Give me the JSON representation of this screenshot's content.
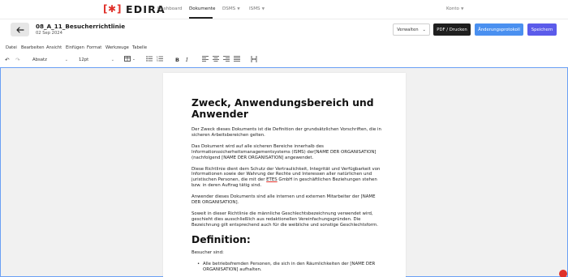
{
  "brand": {
    "name": "EDIRA",
    "color": "#e0312a"
  },
  "nav": {
    "dashboard": "Dashboard",
    "documents": "Dokumente",
    "dsms": "DSMS",
    "isms": "ISMS",
    "account": "Konto"
  },
  "document": {
    "title": "08_A_11_Besucherrichtlinie",
    "date": "02 Sep 2024"
  },
  "actions": {
    "manage": "Verwalten",
    "pdf": "PDF / Drucken",
    "changelog": "Änderungsprotokoll",
    "save": "Speichern"
  },
  "menubar": [
    "Datei",
    "Bearbeiten",
    "Ansicht",
    "Einfügen",
    "Format",
    "Werkzeuge",
    "Tabelle"
  ],
  "toolbar": {
    "block_format": "Absatz",
    "font_size": "12pt",
    "icons": [
      "undo-icon",
      "redo-icon",
      "table-icon",
      "bullet-list-icon",
      "numbered-list-icon",
      "bold-icon",
      "italic-icon",
      "align-left-icon",
      "align-center-icon",
      "align-right-icon",
      "align-justify-icon",
      "page-break-icon"
    ]
  },
  "content": {
    "heading1": "Zweck, Anwendungsbereich und Anwender",
    "p1": "Der Zweck dieses Dokuments ist die Definition der grundsätzlichen Vorschriften, die in sicheren Arbeitsbereichen gelten.",
    "p2": "Das Dokument wird auf alle sicheren Bereiche innerhalb des Informationssicherheitsmanagementsystems (ISMS) der[NAME DER ORGANISATION] (nachfolgend [NAME DER ORGANISATION] angewendet.",
    "p3_a": "Diese Richtlinie dient dem Schutz der Vertraulichkeit, Integrität und Verfügbarkeit von Informationen sowie der Wahrung der Rechte und Interessen aller natürlichen und juristischen Personen, die mit der ",
    "p3_b": "ETES",
    "p3_c": " GmbH in geschäftlichen Beziehungen stehen bzw. in deren Auftrag tätig sind.",
    "p4": "Anwender dieses Dokuments sind alle internen und externen Mitarbeiter der [NAME DER ORGANISATION].",
    "p5": "Soweit in dieser Richtlinie die männliche Geschlechtsbezeichnung verwendet wird, geschieht dies ausschließlich aus redaktionellen Vereinfachungsgründen. Die Bezeichnung gilt entsprechend auch für die weibliche und sonstige Geschlechtsform.",
    "heading2": "Definition:",
    "p6": "Besucher sind:",
    "li1": "Alle betriebsfremden Personen, die sich in den Räumlichkeiten der [NAME DER ORGANISATION] aufhalten."
  },
  "colors": {
    "accent_blue": "#4a90f0",
    "accent_purple": "#5b5bea",
    "dark_button": "#1f1f1f",
    "editor_border": "#6aa0f5"
  }
}
